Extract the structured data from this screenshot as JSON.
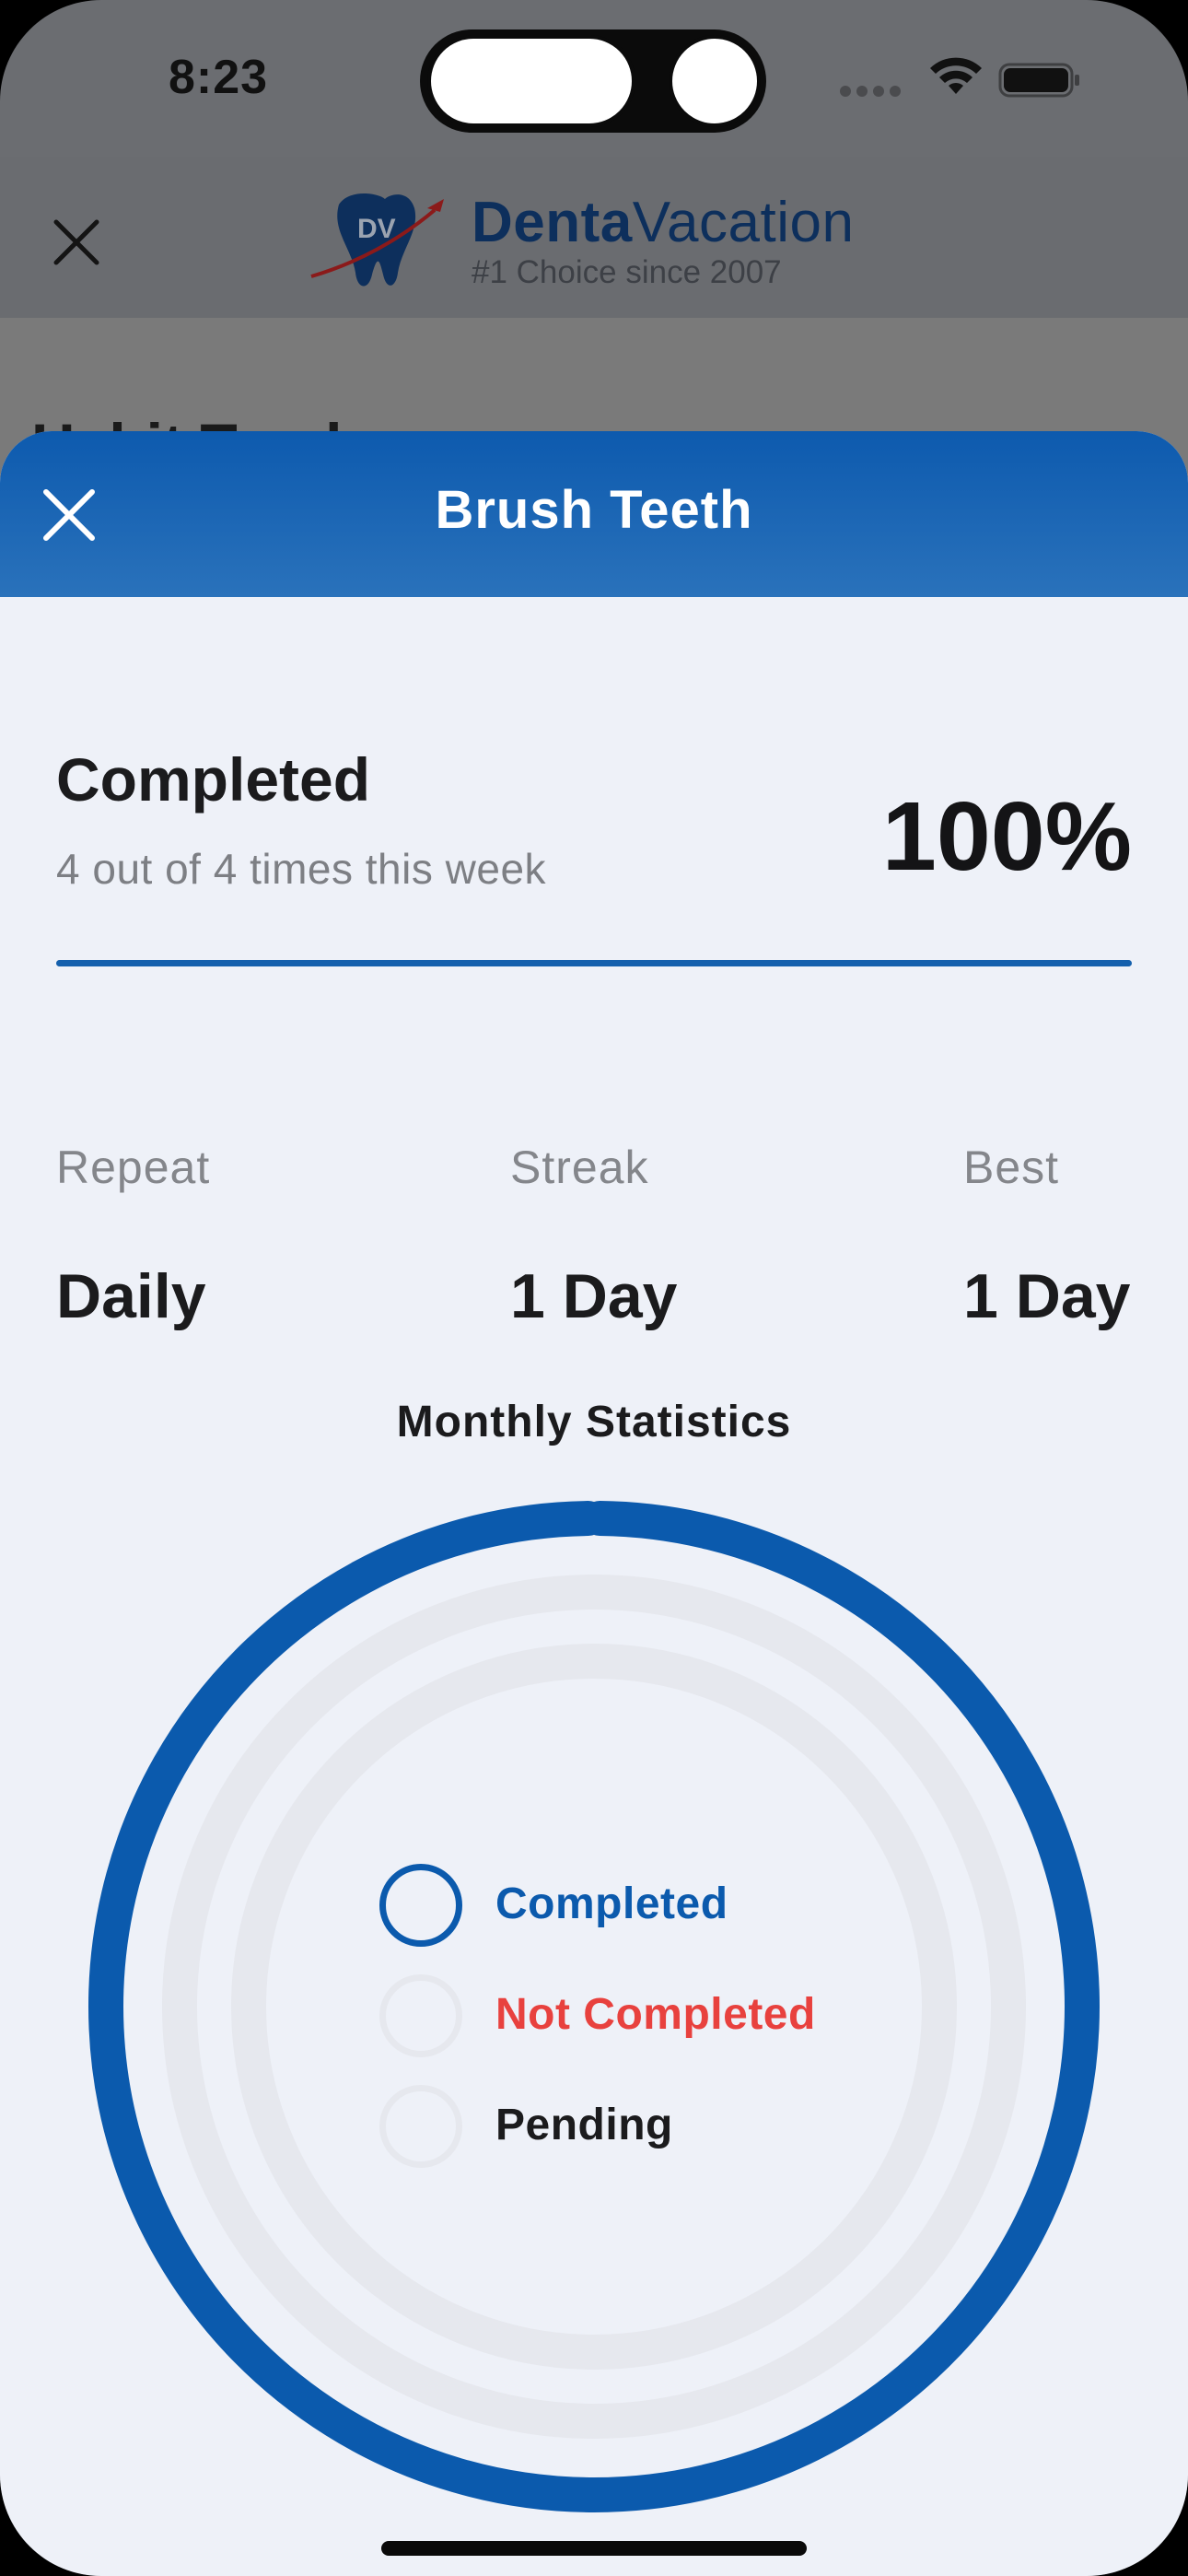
{
  "status_bar": {
    "time": "8:23"
  },
  "background_app": {
    "brand_bold": "Denta",
    "brand_light": "Vacation",
    "brand_tagline": "#1 Choice since 2007",
    "logo_initials": "DV",
    "page_heading": "Habit Track"
  },
  "sheet": {
    "title": "Brush Teeth",
    "summary": {
      "label": "Completed",
      "subtitle": "4 out of 4 times this week",
      "percent_text": "100%",
      "progress": 1.0
    },
    "stats": [
      {
        "label": "Repeat",
        "value": "Daily"
      },
      {
        "label": "Streak",
        "value": "1 Day"
      },
      {
        "label": "Best",
        "value": "1 Day"
      }
    ],
    "monthly_title": "Monthly Statistics"
  },
  "chart_data": {
    "type": "radial",
    "title": "Monthly Statistics",
    "series": [
      {
        "name": "Completed",
        "fraction": 1.0,
        "color": "#0b5aad"
      },
      {
        "name": "Not Completed",
        "fraction": 0.0,
        "color": "#e8413e"
      },
      {
        "name": "Pending",
        "fraction": 0.0,
        "color": "#1b1b1d"
      }
    ],
    "track_color": "#e6e8ee"
  },
  "colors": {
    "accent": "#0b5aad",
    "header_gradient_top": "#0d5aae",
    "header_gradient_bottom": "#2a72bb",
    "sheet_bg": "#eef1f8",
    "not_completed": "#e8413e"
  },
  "icons": {
    "close": "close-icon",
    "wifi": "wifi-icon",
    "battery": "battery-icon"
  }
}
